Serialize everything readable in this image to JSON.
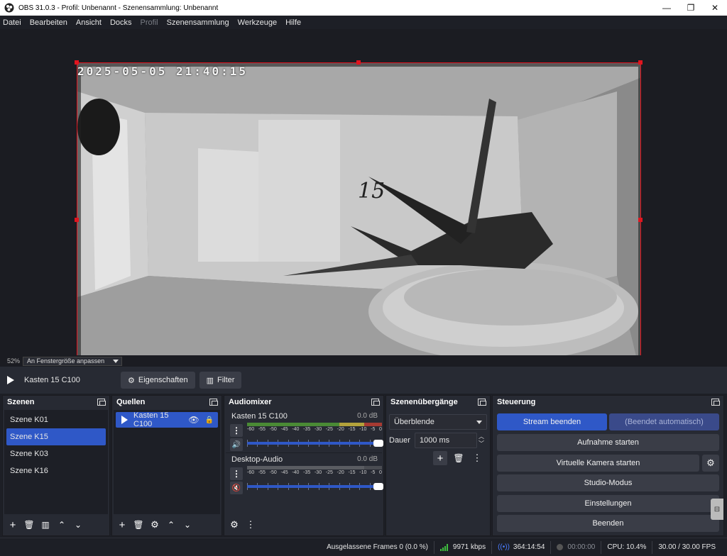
{
  "window": {
    "title": "OBS 31.0.3 - Profil: Unbenannt - Szenensammlung: Unbenannt",
    "controls": [
      "—",
      "❐",
      "✕"
    ]
  },
  "menu": [
    {
      "label": "Datei",
      "enabled": true
    },
    {
      "label": "Bearbeiten",
      "enabled": true
    },
    {
      "label": "Ansicht",
      "enabled": true
    },
    {
      "label": "Docks",
      "enabled": true
    },
    {
      "label": "Profil",
      "enabled": false
    },
    {
      "label": "Szenensammlung",
      "enabled": true
    },
    {
      "label": "Werkzeuge",
      "enabled": true
    },
    {
      "label": "Hilfe",
      "enabled": true
    }
  ],
  "preview": {
    "timestamp": "2025-05-05  21:40:15",
    "zoom_percent": "52%",
    "fit_mode": "An Fenstergröße anpassen"
  },
  "source_toolbar": {
    "source_name": "Kasten 15 C100",
    "properties_label": "Eigenschaften",
    "filter_label": "Filter"
  },
  "scenes": {
    "title": "Szenen",
    "items": [
      "Szene K01",
      "Szene K15",
      "Szene K03",
      "Szene K16"
    ],
    "selected_index": 1
  },
  "sources": {
    "title": "Quellen",
    "items": [
      {
        "name": "Kasten 15 C100",
        "visible": true,
        "locked": true
      }
    ]
  },
  "audiomixer": {
    "title": "Audiomixer",
    "scale": [
      "-60",
      "-55",
      "-50",
      "-45",
      "-40",
      "-35",
      "-30",
      "-25",
      "-20",
      "-15",
      "-10",
      "-5",
      "0"
    ],
    "channels": [
      {
        "name": "Kasten 15 C100",
        "db": "0.0 dB",
        "muted": false,
        "volume": 1.0
      },
      {
        "name": "Desktop-Audio",
        "db": "0.0 dB",
        "muted": true,
        "volume": 1.0
      }
    ]
  },
  "transitions": {
    "title": "Szenenübergänge",
    "selected": "Überblende",
    "duration_label": "Dauer",
    "duration_value": "1000 ms"
  },
  "controls": {
    "title": "Steuerung",
    "stream_stop": "Stream beenden",
    "stream_auto": "(Beendet automatisch)",
    "record_start": "Aufnahme starten",
    "virtualcam_start": "Virtuelle Kamera starten",
    "studio_mode": "Studio-Modus",
    "settings": "Einstellungen",
    "exit": "Beenden"
  },
  "status": {
    "dropped_frames": "Ausgelassene Frames 0 (0.0 %)",
    "bitrate": "9971 kbps",
    "stream_time": "364:14:54",
    "record_time": "00:00:00",
    "cpu": "CPU: 10.4%",
    "fps": "30.00 / 30.00 FPS"
  },
  "colors": {
    "accent": "#2f58c7",
    "selection_border": "#e1141e",
    "live_green": "#3fbf3f"
  }
}
